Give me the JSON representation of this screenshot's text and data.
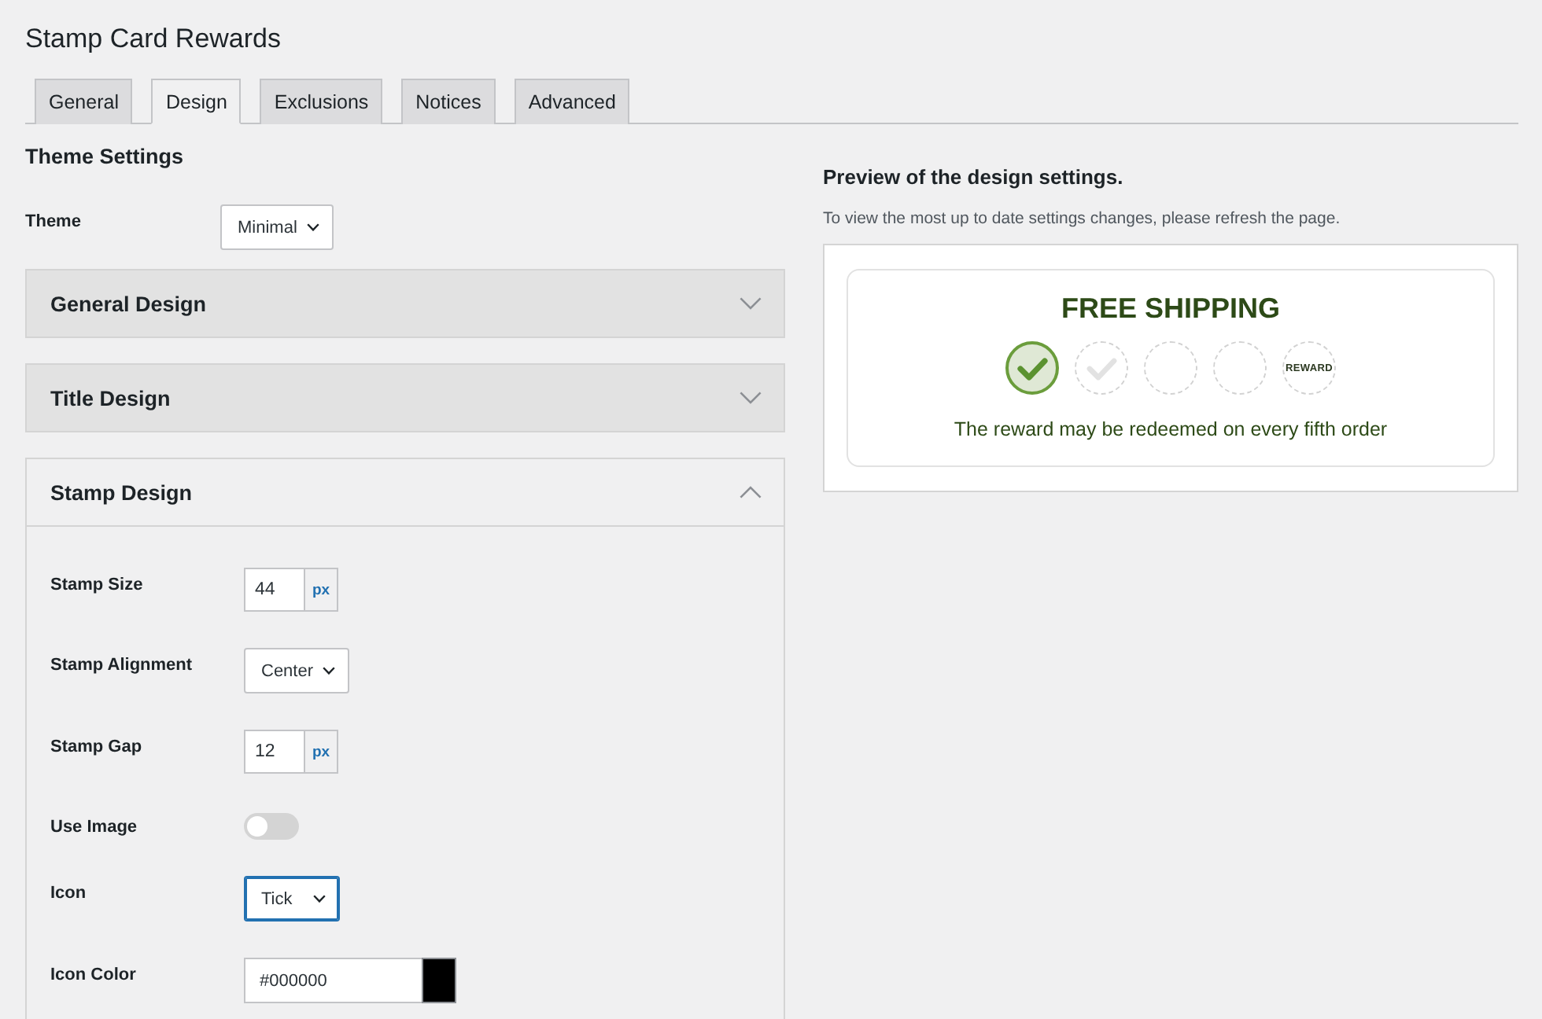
{
  "page": {
    "title": "Stamp Card Rewards"
  },
  "tabs": [
    {
      "label": "General",
      "selected": false
    },
    {
      "label": "Design",
      "selected": true
    },
    {
      "label": "Exclusions",
      "selected": false
    },
    {
      "label": "Notices",
      "selected": false
    },
    {
      "label": "Advanced",
      "selected": false
    }
  ],
  "theme_settings": {
    "heading": "Theme Settings",
    "fields": [
      {
        "label": "Theme",
        "kind": "select",
        "value": "Minimal",
        "focused": false
      }
    ]
  },
  "panels": [
    {
      "title": "General Design",
      "expanded": false
    },
    {
      "title": "Title Design",
      "expanded": false
    },
    {
      "title": "Stamp Design",
      "expanded": true,
      "fields": [
        {
          "label": "Stamp Size",
          "kind": "number",
          "value": "44",
          "unit": "px"
        },
        {
          "label": "Stamp Alignment",
          "kind": "select",
          "value": "Center",
          "focused": false
        },
        {
          "label": "Stamp Gap",
          "kind": "number",
          "value": "12",
          "unit": "px"
        },
        {
          "label": "Use Image",
          "kind": "toggle",
          "on": false
        },
        {
          "label": "Icon",
          "kind": "select",
          "value": "Tick",
          "focused": true
        },
        {
          "label": "Icon Color",
          "kind": "color",
          "value": "#000000",
          "color": "#000000"
        }
      ]
    }
  ],
  "preview": {
    "heading": "Preview of the design settings.",
    "note": "To view the most up to date settings changes, please refresh the page.",
    "card": {
      "title": "FREE SHIPPING",
      "stamps": [
        {
          "kind": "stamped"
        },
        {
          "kind": "hint"
        },
        {
          "kind": "empty"
        },
        {
          "kind": "empty"
        },
        {
          "kind": "reward",
          "label": "REWARD"
        }
      ],
      "footer": "The reward may be redeemed on every fifth order"
    }
  }
}
